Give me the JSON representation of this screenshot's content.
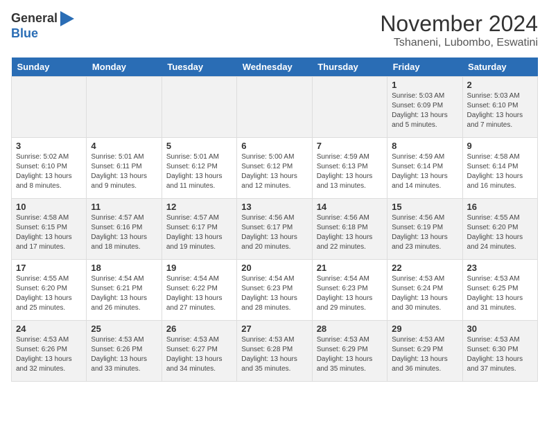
{
  "logo": {
    "text_general": "General",
    "text_blue": "Blue"
  },
  "header": {
    "month_title": "November 2024",
    "location": "Tshaneni, Lubombo, Eswatini"
  },
  "days_of_week": [
    "Sunday",
    "Monday",
    "Tuesday",
    "Wednesday",
    "Thursday",
    "Friday",
    "Saturday"
  ],
  "weeks": [
    [
      {
        "day": "",
        "info": ""
      },
      {
        "day": "",
        "info": ""
      },
      {
        "day": "",
        "info": ""
      },
      {
        "day": "",
        "info": ""
      },
      {
        "day": "",
        "info": ""
      },
      {
        "day": "1",
        "info": "Sunrise: 5:03 AM\nSunset: 6:09 PM\nDaylight: 13 hours and 5 minutes."
      },
      {
        "day": "2",
        "info": "Sunrise: 5:03 AM\nSunset: 6:10 PM\nDaylight: 13 hours and 7 minutes."
      }
    ],
    [
      {
        "day": "3",
        "info": "Sunrise: 5:02 AM\nSunset: 6:10 PM\nDaylight: 13 hours and 8 minutes."
      },
      {
        "day": "4",
        "info": "Sunrise: 5:01 AM\nSunset: 6:11 PM\nDaylight: 13 hours and 9 minutes."
      },
      {
        "day": "5",
        "info": "Sunrise: 5:01 AM\nSunset: 6:12 PM\nDaylight: 13 hours and 11 minutes."
      },
      {
        "day": "6",
        "info": "Sunrise: 5:00 AM\nSunset: 6:12 PM\nDaylight: 13 hours and 12 minutes."
      },
      {
        "day": "7",
        "info": "Sunrise: 4:59 AM\nSunset: 6:13 PM\nDaylight: 13 hours and 13 minutes."
      },
      {
        "day": "8",
        "info": "Sunrise: 4:59 AM\nSunset: 6:14 PM\nDaylight: 13 hours and 14 minutes."
      },
      {
        "day": "9",
        "info": "Sunrise: 4:58 AM\nSunset: 6:14 PM\nDaylight: 13 hours and 16 minutes."
      }
    ],
    [
      {
        "day": "10",
        "info": "Sunrise: 4:58 AM\nSunset: 6:15 PM\nDaylight: 13 hours and 17 minutes."
      },
      {
        "day": "11",
        "info": "Sunrise: 4:57 AM\nSunset: 6:16 PM\nDaylight: 13 hours and 18 minutes."
      },
      {
        "day": "12",
        "info": "Sunrise: 4:57 AM\nSunset: 6:17 PM\nDaylight: 13 hours and 19 minutes."
      },
      {
        "day": "13",
        "info": "Sunrise: 4:56 AM\nSunset: 6:17 PM\nDaylight: 13 hours and 20 minutes."
      },
      {
        "day": "14",
        "info": "Sunrise: 4:56 AM\nSunset: 6:18 PM\nDaylight: 13 hours and 22 minutes."
      },
      {
        "day": "15",
        "info": "Sunrise: 4:56 AM\nSunset: 6:19 PM\nDaylight: 13 hours and 23 minutes."
      },
      {
        "day": "16",
        "info": "Sunrise: 4:55 AM\nSunset: 6:20 PM\nDaylight: 13 hours and 24 minutes."
      }
    ],
    [
      {
        "day": "17",
        "info": "Sunrise: 4:55 AM\nSunset: 6:20 PM\nDaylight: 13 hours and 25 minutes."
      },
      {
        "day": "18",
        "info": "Sunrise: 4:54 AM\nSunset: 6:21 PM\nDaylight: 13 hours and 26 minutes."
      },
      {
        "day": "19",
        "info": "Sunrise: 4:54 AM\nSunset: 6:22 PM\nDaylight: 13 hours and 27 minutes."
      },
      {
        "day": "20",
        "info": "Sunrise: 4:54 AM\nSunset: 6:23 PM\nDaylight: 13 hours and 28 minutes."
      },
      {
        "day": "21",
        "info": "Sunrise: 4:54 AM\nSunset: 6:23 PM\nDaylight: 13 hours and 29 minutes."
      },
      {
        "day": "22",
        "info": "Sunrise: 4:53 AM\nSunset: 6:24 PM\nDaylight: 13 hours and 30 minutes."
      },
      {
        "day": "23",
        "info": "Sunrise: 4:53 AM\nSunset: 6:25 PM\nDaylight: 13 hours and 31 minutes."
      }
    ],
    [
      {
        "day": "24",
        "info": "Sunrise: 4:53 AM\nSunset: 6:26 PM\nDaylight: 13 hours and 32 minutes."
      },
      {
        "day": "25",
        "info": "Sunrise: 4:53 AM\nSunset: 6:26 PM\nDaylight: 13 hours and 33 minutes."
      },
      {
        "day": "26",
        "info": "Sunrise: 4:53 AM\nSunset: 6:27 PM\nDaylight: 13 hours and 34 minutes."
      },
      {
        "day": "27",
        "info": "Sunrise: 4:53 AM\nSunset: 6:28 PM\nDaylight: 13 hours and 35 minutes."
      },
      {
        "day": "28",
        "info": "Sunrise: 4:53 AM\nSunset: 6:29 PM\nDaylight: 13 hours and 35 minutes."
      },
      {
        "day": "29",
        "info": "Sunrise: 4:53 AM\nSunset: 6:29 PM\nDaylight: 13 hours and 36 minutes."
      },
      {
        "day": "30",
        "info": "Sunrise: 4:53 AM\nSunset: 6:30 PM\nDaylight: 13 hours and 37 minutes."
      }
    ]
  ]
}
